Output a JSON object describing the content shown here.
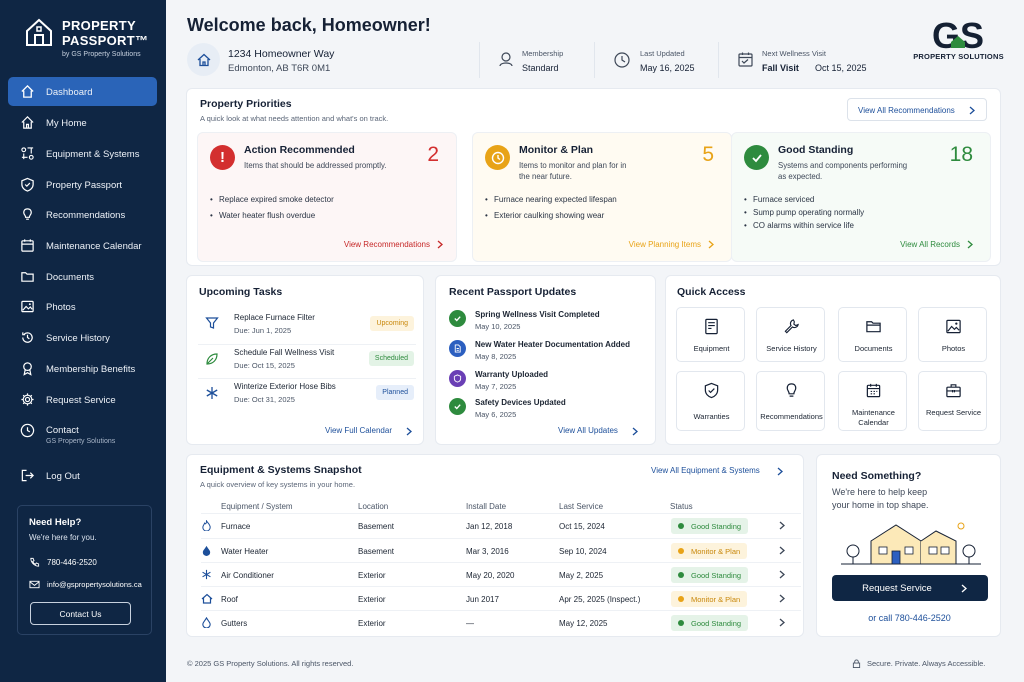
{
  "sidebar": {
    "logo_line1": "PROPERTY",
    "logo_line2": "PASSPORT™",
    "logo_line3": "by GS Property Solutions",
    "nav": [
      {
        "label": "Dashboard",
        "icon": "home-icon"
      },
      {
        "label": "My Home",
        "icon": "house-icon"
      },
      {
        "label": "Equipment & Systems",
        "icon": "equipment-icon"
      },
      {
        "label": "Property Passport",
        "icon": "shield-icon"
      },
      {
        "label": "Recommendations",
        "icon": "lightbulb-icon"
      },
      {
        "label": "Maintenance Calendar",
        "icon": "calendar-icon"
      },
      {
        "label": "Documents",
        "icon": "folder-icon"
      },
      {
        "label": "Photos",
        "icon": "image-icon"
      },
      {
        "label": "Service History",
        "icon": "history-icon"
      },
      {
        "label": "Membership Benefits",
        "icon": "benefits-icon"
      },
      {
        "label": "Request Service",
        "icon": "gear-icon"
      },
      {
        "label": "Contact",
        "sub": "GS Property Solutions",
        "icon": "phone-icon"
      },
      {
        "label": "Log Out",
        "icon": "logout-icon"
      }
    ],
    "help": {
      "title": "Need Help?",
      "subtitle": "We're here for you.",
      "phone": "780-446-2520",
      "email": "info@gspropertysolutions.ca",
      "contact_button": "Contact Us"
    }
  },
  "header": {
    "welcome": "Welcome back, Homeowner!",
    "address_line1": "1234 Homeowner Way",
    "address_line2": "Edmonton, AB  T6R 0M1",
    "membership_label": "Membership",
    "membership_value": "Standard",
    "updated_label": "Last Updated",
    "updated_value": "May 16, 2025",
    "visit_label": "Next Wellness Visit",
    "visit_value1": "Fall Visit",
    "visit_value2": "Oct 15, 2025",
    "brand_mark": "GS",
    "brand_name": "PROPERTY SOLUTIONS"
  },
  "priorities": {
    "title": "Property Priorities",
    "subtitle": "A quick look at what needs attention and what's on track.",
    "view_all": "View All Recommendations",
    "boxes": [
      {
        "title": "Action Recommended",
        "desc": "Items that should be addressed promptly.",
        "count": "2",
        "bullets": [
          "Replace expired smoke detector",
          "Water heater flush overdue"
        ],
        "link": "View Recommendations",
        "color": "#d32f2f"
      },
      {
        "title": "Monitor & Plan",
        "desc": "Items to monitor and plan for in the near future.",
        "count": "5",
        "bullets": [
          "Furnace nearing expected lifespan",
          "Exterior caulking showing wear"
        ],
        "link": "View Planning Items",
        "color": "#e8a317"
      },
      {
        "title": "Good Standing",
        "desc": "Systems and components performing as expected.",
        "count": "18",
        "bullets": [
          "Furnace serviced",
          "Sump pump operating normally",
          "CO alarms within service life"
        ],
        "link": "View All Records",
        "color": "#2e8b3e"
      }
    ]
  },
  "tasks": {
    "title": "Upcoming Tasks",
    "items": [
      {
        "name": "Replace Furnace Filter",
        "due": "Due: Jun 1, 2025",
        "tag": "Upcoming"
      },
      {
        "name": "Schedule Fall Wellness Visit",
        "due": "Due: Oct 15, 2025",
        "tag": "Scheduled"
      },
      {
        "name": "Winterize Exterior Hose Bibs",
        "due": "Due: Oct 31, 2025",
        "tag": "Planned"
      }
    ],
    "link": "View Full Calendar"
  },
  "updates": {
    "title": "Recent Passport Updates",
    "items": [
      {
        "name": "Spring Wellness Visit Completed",
        "date": "May 10, 2025"
      },
      {
        "name": "New Water Heater Documentation Added",
        "date": "May 8, 2025"
      },
      {
        "name": "Warranty Uploaded",
        "date": "May 7, 2025"
      },
      {
        "name": "Safety Devices Updated",
        "date": "May 6, 2025"
      }
    ],
    "link": "View All Updates"
  },
  "quick": {
    "title": "Quick Access",
    "items": [
      {
        "label": "Equipment"
      },
      {
        "label": "Service History"
      },
      {
        "label": "Documents"
      },
      {
        "label": "Photos"
      },
      {
        "label": "Warranties"
      },
      {
        "label": "Recommendations"
      },
      {
        "label": "Maintenance Calendar"
      },
      {
        "label": "Request Service"
      }
    ]
  },
  "equipment": {
    "title": "Equipment & Systems Snapshot",
    "subtitle": "A quick overview of key systems in your home.",
    "link": "View All Equipment & Systems",
    "columns": [
      "Equipment / System",
      "Location",
      "Install Date",
      "Last Service",
      "Status"
    ],
    "rows": [
      {
        "name": "Furnace",
        "location": "Basement",
        "install": "Jan 12, 2018",
        "service": "Oct 15, 2024",
        "status": "Good Standing"
      },
      {
        "name": "Water Heater",
        "location": "Basement",
        "install": "Mar 3, 2016",
        "service": "Sep 10, 2024",
        "status": "Monitor & Plan"
      },
      {
        "name": "Air Conditioner",
        "location": "Exterior",
        "install": "May 20, 2020",
        "service": "May 2, 2025",
        "status": "Good Standing"
      },
      {
        "name": "Roof",
        "location": "Exterior",
        "install": "Jun 2017",
        "service": "Apr 25, 2025 (Inspect.)",
        "status": "Monitor & Plan"
      },
      {
        "name": "Gutters",
        "location": "Exterior",
        "install": "—",
        "service": "May 12, 2025",
        "status": "Good Standing"
      }
    ]
  },
  "need": {
    "title": "Need Something?",
    "text1": "We're here to help keep",
    "text2": "your home in top shape.",
    "button": "Request Service",
    "call": "or call 780-446-2520"
  },
  "footer": {
    "copyright": "© 2025 GS Property Solutions. All rights reserved.",
    "tagline": "Secure. Private. Always Accessible."
  },
  "colors": {
    "navy": "#0f2644",
    "blue": "#1d4f9a",
    "red": "#d32f2f",
    "amber": "#e8a317",
    "green": "#2e8b3e"
  }
}
